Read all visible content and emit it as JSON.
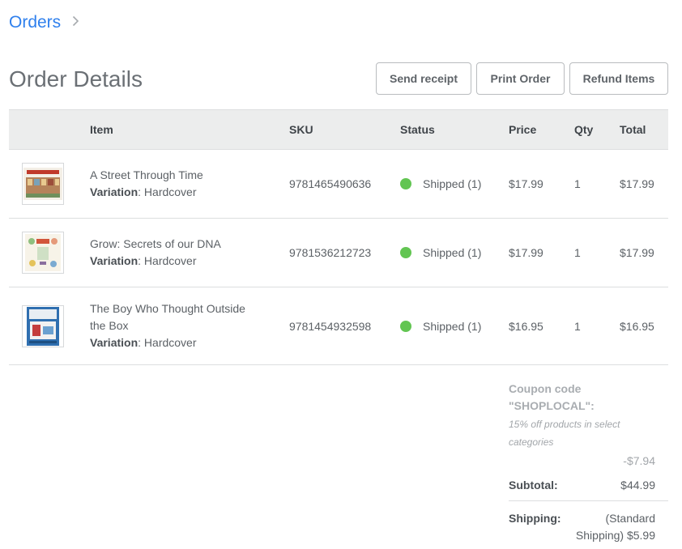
{
  "breadcrumb": {
    "orders_label": "Orders"
  },
  "page": {
    "title": "Order Details"
  },
  "actions": {
    "send_receipt": "Send receipt",
    "print_order": "Print Order",
    "refund_items": "Refund Items"
  },
  "table": {
    "headers": {
      "item": "Item",
      "sku": "SKU",
      "status": "Status",
      "price": "Price",
      "qty": "Qty",
      "total": "Total"
    },
    "variation_label": "Variation",
    "rows": [
      {
        "name": "A Street Through Time",
        "name_line2": "",
        "variation": ": Hardcover",
        "sku": "9781465490636",
        "status": "Shipped (1)",
        "price": "$17.99",
        "qty": "1",
        "total": "$17.99"
      },
      {
        "name": "Grow: Secrets of our DNA",
        "name_line2": "",
        "variation": ": Hardcover",
        "sku": "9781536212723",
        "status": "Shipped (1)",
        "price": "$17.99",
        "qty": "1",
        "total": "$17.99"
      },
      {
        "name": "The Boy Who Thought Outside",
        "name_line2": "the Box",
        "variation": ": Hardcover",
        "sku": "9781454932598",
        "status": "Shipped (1)",
        "price": "$16.95",
        "qty": "1",
        "total": "$16.95"
      }
    ]
  },
  "summary": {
    "coupon_line1": "Coupon code",
    "coupon_line2": "\"SHOPLOCAL\":",
    "coupon_desc": "15% off products in select categories",
    "coupon_amount": "-$7.94",
    "subtotal_label": "Subtotal:",
    "subtotal_value": "$44.99",
    "shipping_label": "Shipping:",
    "shipping_value_line1": "(Standard",
    "shipping_value_line2": "Shipping) $5.99"
  },
  "colors": {
    "link": "#2f80ed",
    "status_shipped": "#62c552",
    "header_bg": "#eceded"
  }
}
